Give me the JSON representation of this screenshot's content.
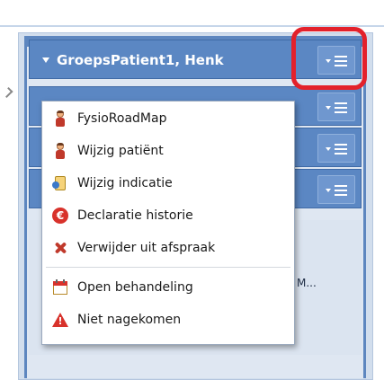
{
  "rows": [
    {
      "title": "GroepsPatient1, Henk"
    },
    {
      "title": ""
    },
    {
      "title": ""
    },
    {
      "title": ""
    }
  ],
  "context_menu": {
    "items": [
      {
        "label": "FysioRoadMap",
        "icon": "person-icon"
      },
      {
        "label": "Wijzig patiënt",
        "icon": "person-icon"
      },
      {
        "label": "Wijzig indicatie",
        "icon": "document-icon"
      },
      {
        "label": "Declaratie historie",
        "icon": "euro-icon"
      },
      {
        "label": "Verwijder uit afspraak",
        "icon": "remove-icon"
      },
      {
        "label": "Open behandeling",
        "icon": "calendar-icon"
      },
      {
        "label": "Niet nagekomen",
        "icon": "warning-icon"
      }
    ]
  },
  "appointment_snippet": "M...",
  "colors": {
    "row_header": "#5b87c3",
    "highlight": "#e3212b",
    "panel_bg": "#d2deed"
  }
}
